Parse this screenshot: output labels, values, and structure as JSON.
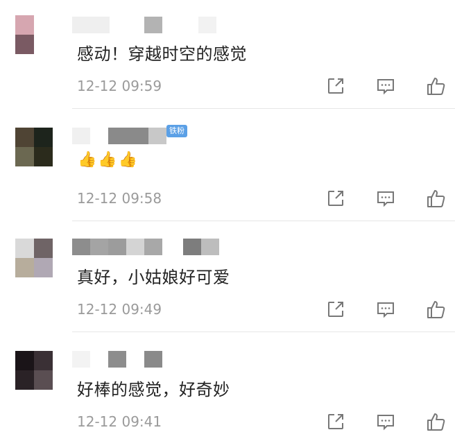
{
  "comments": [
    {
      "text": "感动！穿越时空的感觉",
      "time": "12-12 09:59"
    },
    {
      "text": "👍👍👍",
      "time": "12-12 09:58",
      "badge": "铁粉"
    },
    {
      "text": "真好，小姑娘好可爱",
      "time": "12-12 09:49"
    },
    {
      "text": "好棒的感觉，好奇妙",
      "time": "12-12 09:41"
    }
  ],
  "icons": {
    "share": "share-icon",
    "reply": "comment-icon",
    "like": "thumbs-up-icon"
  }
}
